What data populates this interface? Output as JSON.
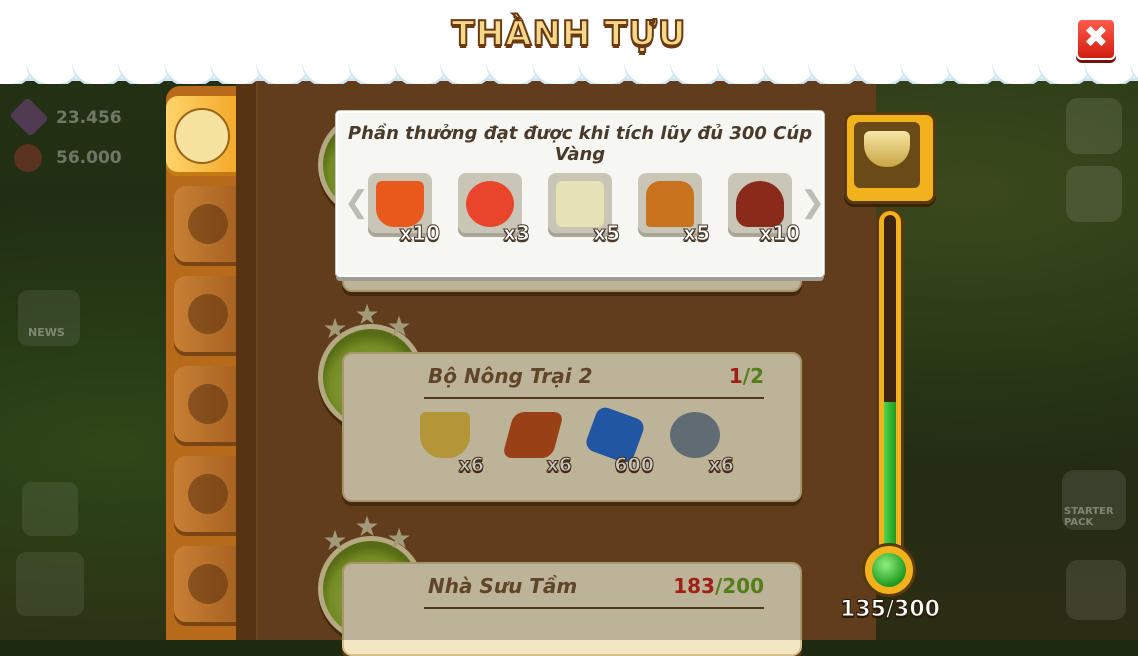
{
  "title": "THÀNH TỰU",
  "close_label": "✖",
  "hud": {
    "gems": "23.456",
    "apples": "56.000",
    "news_label": "NEWS",
    "starter_label": "STARTER PACK"
  },
  "popup": {
    "header": "Phần thưởng đạt được khi tích lũy đủ 300 Cúp Vàng",
    "prev_arrow": "❮",
    "next_arrow": "❯",
    "rewards": [
      {
        "icon": "bucket-icon",
        "count": "x10",
        "color": "#e85a1c"
      },
      {
        "icon": "potion-icon",
        "count": "x3",
        "color": "#e8452a"
      },
      {
        "icon": "cheese-block-icon",
        "count": "x5",
        "color": "#e6e2b6"
      },
      {
        "icon": "tree-stump-icon",
        "count": "x5",
        "color": "#c8741e"
      },
      {
        "icon": "treasure-pouch-icon",
        "count": "x10",
        "color": "#8a2a1a"
      }
    ]
  },
  "achievements": [
    {
      "name": "Bộ Nông Trại 2",
      "progress_current": "1",
      "progress_total": "/2",
      "rewards": [
        {
          "icon": "golden-cup-icon",
          "count": "x6",
          "color": "#e7c04a"
        },
        {
          "icon": "brick-icon",
          "count": "x6",
          "color": "#c4521e"
        },
        {
          "icon": "blue-star-icon",
          "count": "600",
          "color": "#2b6fd0"
        },
        {
          "icon": "nail-icon",
          "count": "x6",
          "color": "#7c8a94"
        }
      ]
    },
    {
      "name": "Nhà Sưu Tầm",
      "progress_current": "183",
      "progress_total": "/200",
      "rewards": []
    }
  ],
  "thermometer": {
    "value": 135,
    "max": 300,
    "label": "135/300"
  },
  "colors": {
    "accent": "#f2b21c",
    "progress_green": "#2fb22a",
    "panel_brown": "#7d4f24"
  }
}
